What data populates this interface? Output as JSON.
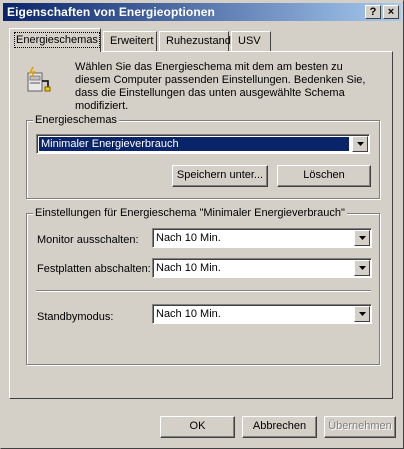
{
  "window": {
    "title": "Eigenschaften von Energieoptionen",
    "help_label": "?",
    "close_label": "×"
  },
  "tabs": [
    {
      "label": "Energieschemas",
      "active": true
    },
    {
      "label": "Erweitert",
      "active": false
    },
    {
      "label": "Ruhezustand",
      "active": false
    },
    {
      "label": "USV",
      "active": false
    }
  ],
  "intro": {
    "icon": "power-options-icon",
    "text": "Wählen Sie das Energieschema mit dem am besten zu diesem Computer passenden Einstellungen. Bedenken Sie, dass die Einstellungen das unten ausgewählte Schema modifiziert."
  },
  "schemes_group": {
    "legend": "Energieschemas",
    "selected_scheme": "Minimaler Energieverbrauch",
    "save_as_label": "Speichern unter...",
    "delete_label": "Löschen"
  },
  "settings_group": {
    "legend": "Einstellungen für Energieschema \"Minimaler Energieverbrauch\"",
    "monitor_label": "Monitor ausschalten:",
    "monitor_value": "Nach 10 Min.",
    "disks_label": "Festplatten abschalten:",
    "disks_value": "Nach 10 Min.",
    "standby_label": "Standbymodus:",
    "standby_value": "Nach 10 Min."
  },
  "footer": {
    "ok_label": "OK",
    "cancel_label": "Abbrechen",
    "apply_label": "Übernehmen",
    "apply_disabled": true
  },
  "colors": {
    "face": "#d4d0c8",
    "title_start": "#0a246a",
    "title_end": "#a6caf0",
    "selection": "#0a246a"
  }
}
